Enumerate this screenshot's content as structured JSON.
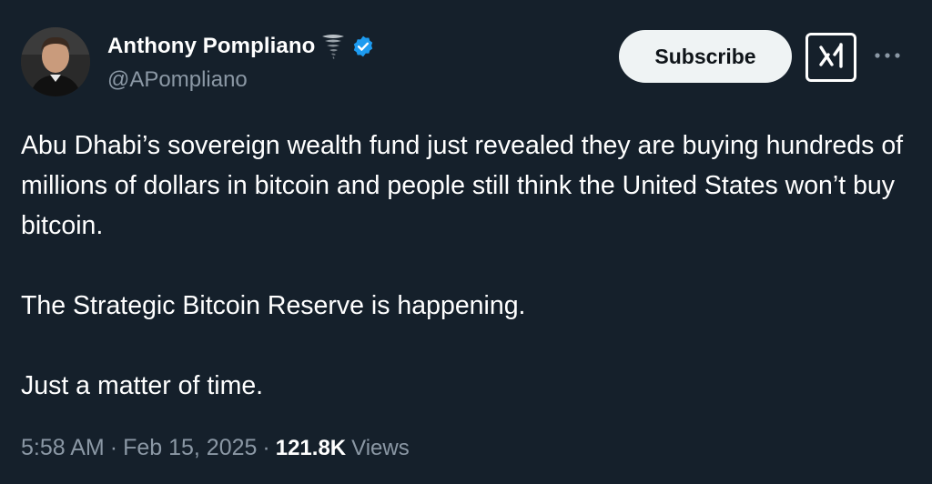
{
  "author": {
    "display_name": "Anthony Pompliano",
    "handle": "@APompliano",
    "name_emoji": "tornado-icon",
    "verified": true,
    "verified_color": "#1d9bf0"
  },
  "actions": {
    "subscribe_label": "Subscribe",
    "grok_icon": "grok-icon",
    "more_icon": "more-options-icon"
  },
  "tweet": {
    "paragraphs": [
      "Abu Dhabi’s sovereign wealth fund just revealed they are buying hundreds of millions of dollars in bitcoin and people still think the United States won’t buy bitcoin.",
      "The Strategic Bitcoin Reserve is happening.",
      "Just a matter of time."
    ]
  },
  "meta": {
    "time": "5:58 AM",
    "separator": "·",
    "date": "Feb 15, 2025",
    "views_count": "121.8K",
    "views_label": "Views"
  },
  "colors": {
    "background": "#15202b",
    "text": "#ffffff",
    "secondary_text": "#8b98a5",
    "button_bg": "#eff3f4"
  }
}
